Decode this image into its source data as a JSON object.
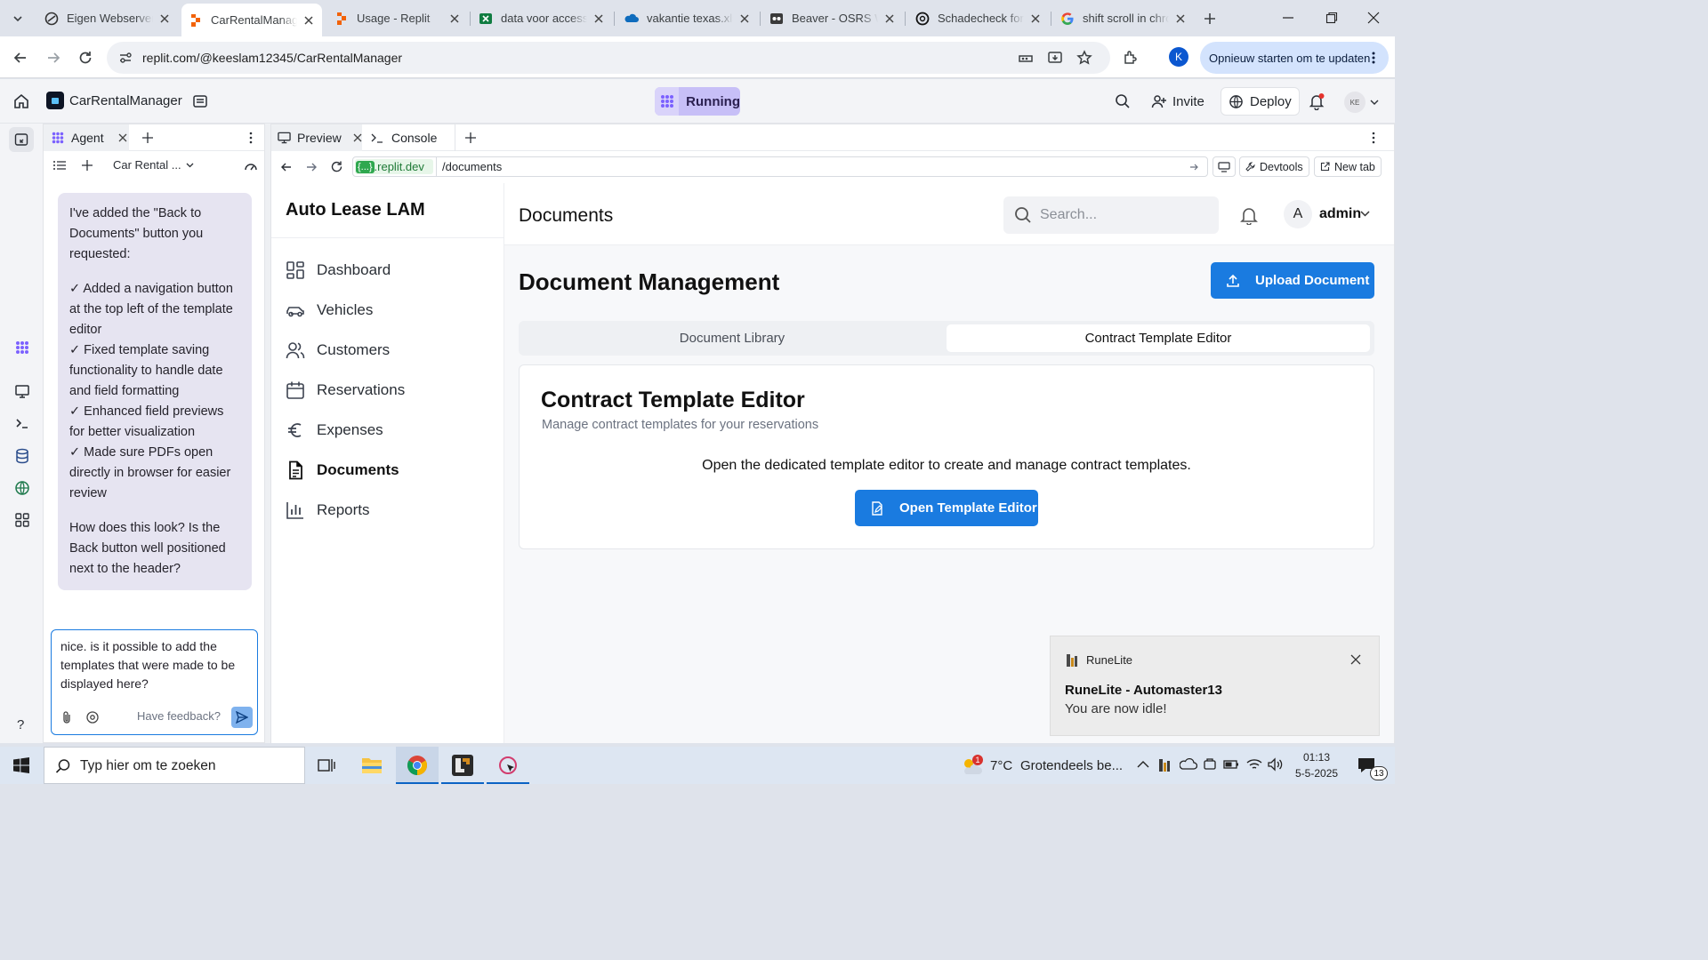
{
  "browser": {
    "tabs": [
      {
        "title": "Eigen Webserver",
        "icon": "webserver-icon"
      },
      {
        "title": "CarRentalManager",
        "icon": "replit-icon"
      },
      {
        "title": "Usage - Replit",
        "icon": "replit-icon"
      },
      {
        "title": "data voor access",
        "icon": "excel-icon"
      },
      {
        "title": "vakantie texas.xlsx",
        "icon": "onedrive-icon"
      },
      {
        "title": "Beaver - OSRS Wiki",
        "icon": "osrs-icon"
      },
      {
        "title": "Schadecheck for",
        "icon": "chatgpt-icon"
      },
      {
        "title": "shift scroll in chrome",
        "icon": "google-icon"
      }
    ],
    "url": "replit.com/@keeslam12345/CarRentalManager",
    "profile_initial": "K",
    "restart_label": "Opnieuw starten om te updaten"
  },
  "replit": {
    "project_name": "CarRentalManager",
    "status": "Running",
    "invite_label": "Invite",
    "deploy_label": "Deploy",
    "avatar_initials": "KE",
    "agent_tab": "Agent",
    "thread_title": "Car Rental ...",
    "preview_tab": "Preview",
    "console_tab": "Console",
    "preview_domain": ".replit.dev",
    "preview_domain_badge": "{...}",
    "preview_path": "/documents",
    "devtools_label": "Devtools",
    "newtab_label": "New tab",
    "agent_message": [
      "I've added the \"Back to Documents\" button you requested:",
      "✓ Added a navigation button at the top left of the template editor",
      "✓ Fixed template saving functionality to handle date and field formatting",
      "✓ Enhanced field previews for better visualization",
      "✓ Made sure PDFs open directly in browser for easier review",
      "How does this look? Is the Back button well positioned next to the header?"
    ],
    "input_value": "nice. is it possible to add the templates that were made to be displayed here?",
    "feedback_label": "Have feedback?",
    "help_label": "?"
  },
  "app": {
    "brand": "Auto Lease LAM",
    "nav": [
      {
        "label": "Dashboard",
        "icon": "dashboard-icon"
      },
      {
        "label": "Vehicles",
        "icon": "car-icon"
      },
      {
        "label": "Customers",
        "icon": "users-icon"
      },
      {
        "label": "Reservations",
        "icon": "calendar-icon"
      },
      {
        "label": "Expenses",
        "icon": "euro-icon"
      },
      {
        "label": "Documents",
        "icon": "document-icon"
      },
      {
        "label": "Reports",
        "icon": "chart-icon"
      }
    ],
    "active_nav": "Documents",
    "page_title": "Documents",
    "search_placeholder": "Search...",
    "user_initial": "A",
    "user_name": "admin",
    "heading": "Document Management",
    "upload_label": "Upload Document",
    "tabs": [
      "Document Library",
      "Contract Template Editor"
    ],
    "active_tab": "Contract Template Editor",
    "card_title": "Contract Template Editor",
    "card_subtitle": "Manage contract templates for your reservations",
    "card_text": "Open the dedicated template editor to create and manage contract templates.",
    "open_editor_label": "Open Template Editor",
    "accent": "#1a7be0"
  },
  "notification": {
    "app": "RuneLite",
    "title": "RuneLite - Automaster13",
    "body": "You are now idle!"
  },
  "taskbar": {
    "search_placeholder": "Typ hier om te zoeken",
    "weather_temp": "7°C",
    "weather_text": "Grotendeels be...",
    "weather_badge": "1",
    "time": "01:13",
    "date": "5-5-2025",
    "notif_count": "13"
  }
}
